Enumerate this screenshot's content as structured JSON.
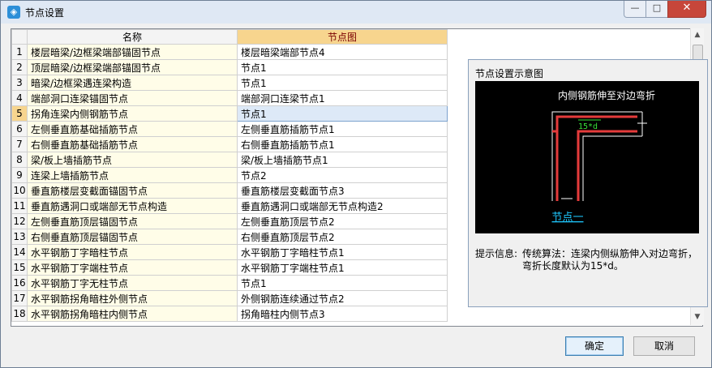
{
  "window": {
    "title": "节点设置",
    "app_icon": "app-logo-icon",
    "minimize_glyph": "—",
    "maximize_glyph": "□",
    "close_glyph": "✕"
  },
  "grid": {
    "col_name": "名称",
    "col_node": "节点图",
    "selected_row": 5,
    "rows": [
      {
        "num": "1",
        "name": "楼层暗梁/边框梁端部锚固节点",
        "node": "楼层暗梁端部节点4"
      },
      {
        "num": "2",
        "name": "顶层暗梁/边框梁端部锚固节点",
        "node": "节点1"
      },
      {
        "num": "3",
        "name": "暗梁/边框梁遇连梁构造",
        "node": "节点1"
      },
      {
        "num": "4",
        "name": "端部洞口连梁锚固节点",
        "node": "端部洞口连梁节点1"
      },
      {
        "num": "5",
        "name": "拐角连梁内侧钢筋节点",
        "node": "节点1"
      },
      {
        "num": "6",
        "name": "左侧垂直筋基础插筋节点",
        "node": "左侧垂直筋插筋节点1"
      },
      {
        "num": "7",
        "name": "右侧垂直筋基础插筋节点",
        "node": "右侧垂直筋插筋节点1"
      },
      {
        "num": "8",
        "name": "梁/板上墙插筋节点",
        "node": "梁/板上墙插筋节点1"
      },
      {
        "num": "9",
        "name": "连梁上墙插筋节点",
        "node": "节点2"
      },
      {
        "num": "10",
        "name": "垂直筋楼层变截面锚固节点",
        "node": "垂直筋楼层变截面节点3"
      },
      {
        "num": "11",
        "name": "垂直筋遇洞口或端部无节点构造",
        "node": "垂直筋遇洞口或端部无节点构造2"
      },
      {
        "num": "12",
        "name": "左侧垂直筋顶层锚固节点",
        "node": "左侧垂直筋顶层节点2"
      },
      {
        "num": "13",
        "name": "右侧垂直筋顶层锚固节点",
        "node": "右侧垂直筋顶层节点2"
      },
      {
        "num": "14",
        "name": "水平钢筋丁字暗柱节点",
        "node": "水平钢筋丁字暗柱节点1"
      },
      {
        "num": "15",
        "name": "水平钢筋丁字端柱节点",
        "node": "水平钢筋丁字端柱节点1"
      },
      {
        "num": "16",
        "name": "水平钢筋丁字无柱节点",
        "node": "节点1"
      },
      {
        "num": "17",
        "name": "水平钢筋拐角暗柱外侧节点",
        "node": "外侧钢筋连续通过节点2"
      },
      {
        "num": "18",
        "name": "水平钢筋拐角暗柱内侧节点",
        "node": "拐角暗柱内侧节点3"
      }
    ]
  },
  "scrollbar": {
    "up_glyph": "▲",
    "down_glyph": "▼"
  },
  "preview": {
    "title": "节点设置示意图",
    "caption": "内侧钢筋伸至对边弯折",
    "dim_label": "15*d",
    "node_name": "节点一",
    "hint_label": "提示信息:",
    "hint_text": "传统算法：连梁内侧纵筋伸入对边弯折，弯折长度默认为15*d。",
    "colors": {
      "bar": "#e53b3b",
      "dim": "#38e038",
      "link": "#1ec8ff",
      "outline": "#ffffff"
    }
  },
  "buttons": {
    "ok": "确定",
    "cancel": "取消"
  }
}
